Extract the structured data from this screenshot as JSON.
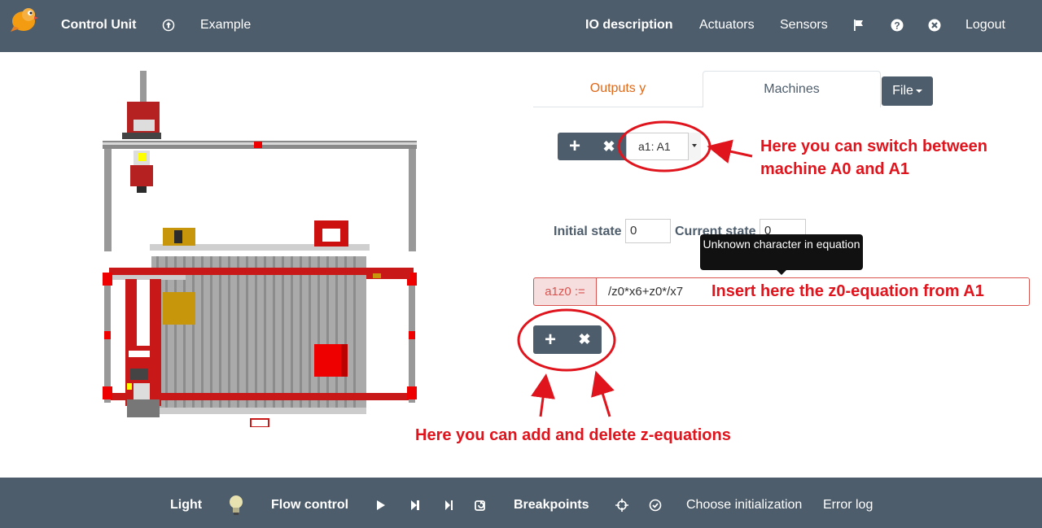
{
  "navbar": {
    "brand": "Control Unit",
    "example": "Example",
    "io_description": "IO description",
    "actuators": "Actuators",
    "sensors": "Sensors",
    "logout": "Logout"
  },
  "tabs": {
    "outputs": "Outputs y",
    "machines": "Machines",
    "file": "File"
  },
  "machine_select": {
    "value": "a1: A1"
  },
  "states": {
    "initial_label": "Initial state",
    "initial_value": "0",
    "current_label": "Current state",
    "current_value": "0"
  },
  "tooltip": {
    "text": "Unknown character in equation"
  },
  "equation": {
    "label": "a1z0 :=",
    "value": "/z0*x6+z0*/x7"
  },
  "annotations": {
    "switch_line1": "Here you can switch between",
    "switch_line2": "machine A0 and A1",
    "insert": "Insert here the z0-equation from A1",
    "add_delete": "Here you can add and delete z-equations"
  },
  "footer": {
    "light": "Light",
    "flow_control": "Flow control",
    "breakpoints": "Breakpoints",
    "choose_init": "Choose initialization",
    "error_log": "Error log"
  },
  "colors": {
    "navbar": "#4e5d6c",
    "accent_orange": "#df691a",
    "annotation_red": "#e0141d",
    "error_red": "#d9534f"
  }
}
